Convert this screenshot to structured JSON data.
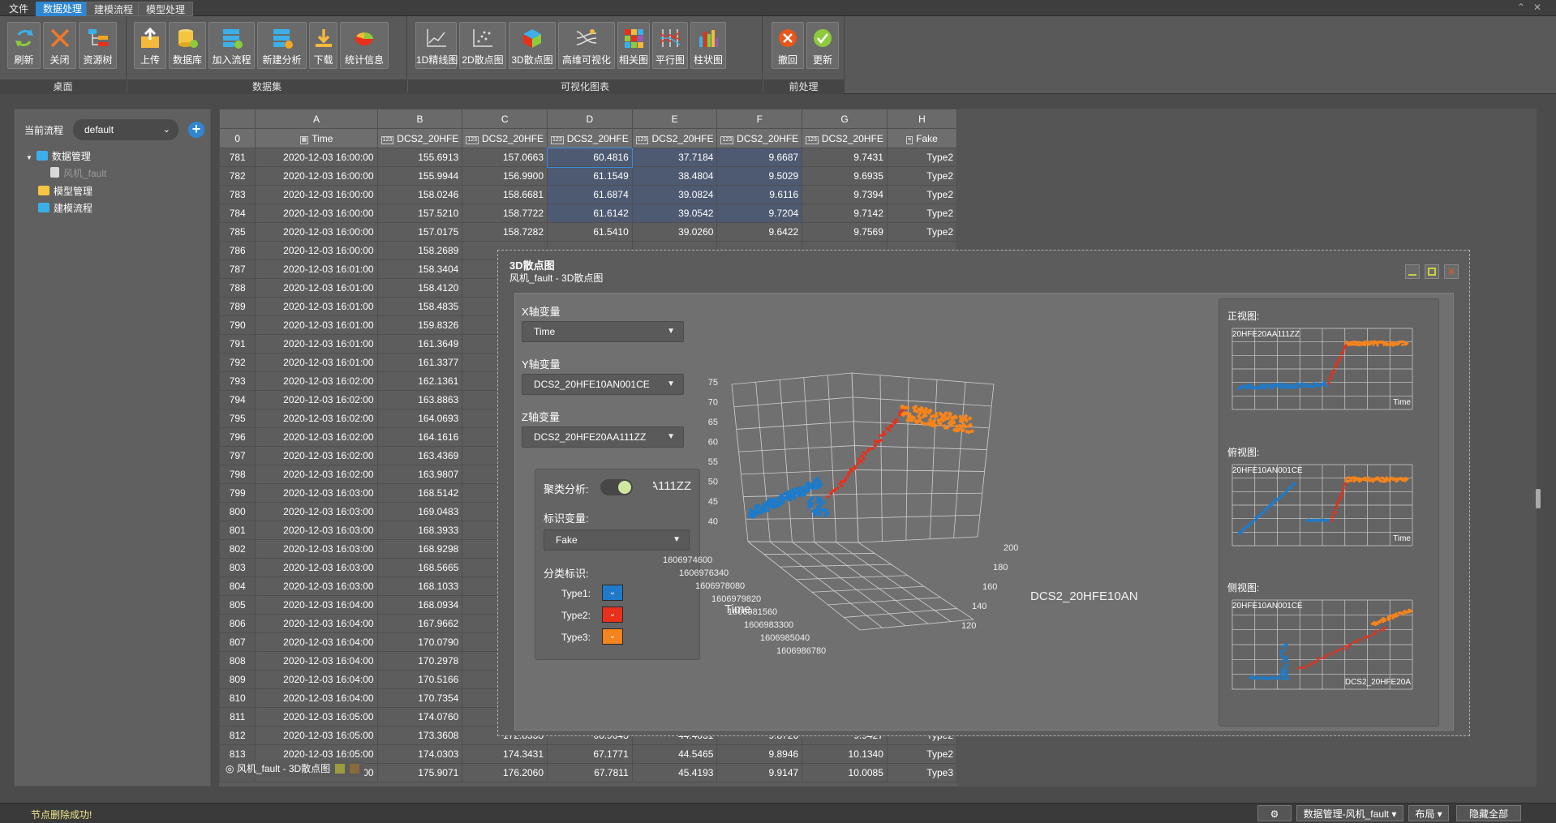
{
  "menubar": {
    "items": [
      "文件",
      "数据处理",
      "建模流程",
      "模型处理"
    ],
    "active": "数据处理"
  },
  "ribbon": {
    "groups": [
      {
        "label": "桌面",
        "buttons": [
          "刷新",
          "关闭",
          "资源树"
        ]
      },
      {
        "label": "数据集",
        "buttons": [
          "上传",
          "数据库",
          "加入流程",
          "新建分析",
          "下载",
          "统计信息"
        ]
      },
      {
        "label": "可视化图表",
        "buttons": [
          "1D精线图",
          "2D散点图",
          "3D散点图",
          "高维可视化",
          "相关图",
          "平行图",
          "柱状图"
        ]
      },
      {
        "label": "前处理",
        "buttons": [
          "撤回",
          "更新"
        ]
      }
    ]
  },
  "sidebar": {
    "flow_label": "当前流程",
    "flow_value": "default",
    "tree": [
      "数据管理",
      "风机_fault",
      "模型管理",
      "建模流程"
    ]
  },
  "grid": {
    "col_letters": [
      "A",
      "B",
      "C",
      "D",
      "E",
      "F",
      "G",
      "H"
    ],
    "header_index": "0",
    "headers": [
      "Time",
      "DCS2_20HFE",
      "DCS2_20HFE",
      "DCS2_20HFE",
      "DCS2_20HFE",
      "DCS2_20HFE",
      "DCS2_20HFE",
      "Fake"
    ],
    "full_rows": [
      [
        "781",
        "2020-12-03 16:00:00",
        "155.6913",
        "157.0663",
        "60.4816",
        "37.7184",
        "9.6687",
        "9.7431",
        "Type2"
      ],
      [
        "782",
        "2020-12-03 16:00:00",
        "155.9944",
        "156.9900",
        "61.1549",
        "38.4804",
        "9.5029",
        "9.6935",
        "Type2"
      ],
      [
        "783",
        "2020-12-03 16:00:00",
        "158.0246",
        "158.6681",
        "61.6874",
        "39.0824",
        "9.6116",
        "9.7394",
        "Type2"
      ],
      [
        "784",
        "2020-12-03 16:00:00",
        "157.5210",
        "158.7722",
        "61.6142",
        "39.0542",
        "9.7204",
        "9.7142",
        "Type2"
      ],
      [
        "785",
        "2020-12-03 16:00:00",
        "157.0175",
        "158.7282",
        "61.5410",
        "39.0260",
        "9.6422",
        "9.7569",
        "Type2"
      ]
    ],
    "partial_rows": [
      [
        "786",
        "2020-12-03 16:00:00",
        "158.2689"
      ],
      [
        "787",
        "2020-12-03 16:01:00",
        "158.3404"
      ],
      [
        "788",
        "2020-12-03 16:01:00",
        "158.4120"
      ],
      [
        "789",
        "2020-12-03 16:01:00",
        "158.4835"
      ],
      [
        "790",
        "2020-12-03 16:01:00",
        "159.8326"
      ],
      [
        "791",
        "2020-12-03 16:01:00",
        "161.3649"
      ],
      [
        "792",
        "2020-12-03 16:01:00",
        "161.3377"
      ],
      [
        "793",
        "2020-12-03 16:02:00",
        "162.1361"
      ],
      [
        "794",
        "2020-12-03 16:02:00",
        "163.8863"
      ],
      [
        "795",
        "2020-12-03 16:02:00",
        "164.0693"
      ],
      [
        "796",
        "2020-12-03 16:02:00",
        "164.1616"
      ],
      [
        "797",
        "2020-12-03 16:02:00",
        "163.4369"
      ],
      [
        "798",
        "2020-12-03 16:02:00",
        "163.9807"
      ],
      [
        "799",
        "2020-12-03 16:03:00",
        "168.5142"
      ],
      [
        "800",
        "2020-12-03 16:03:00",
        "169.0483"
      ],
      [
        "801",
        "2020-12-03 16:03:00",
        "168.3933"
      ],
      [
        "802",
        "2020-12-03 16:03:00",
        "168.9298"
      ],
      [
        "803",
        "2020-12-03 16:03:00",
        "168.5665"
      ],
      [
        "804",
        "2020-12-03 16:03:00",
        "168.1033"
      ],
      [
        "805",
        "2020-12-03 16:04:00",
        "168.0934"
      ],
      [
        "806",
        "2020-12-03 16:04:00",
        "167.9662"
      ],
      [
        "807",
        "2020-12-03 16:04:00",
        "170.0790"
      ],
      [
        "808",
        "2020-12-03 16:04:00",
        "170.2978"
      ],
      [
        "809",
        "2020-12-03 16:04:00",
        "170.5166"
      ],
      [
        "810",
        "2020-12-03 16:04:00",
        "170.7354"
      ],
      [
        "811",
        "2020-12-03 16:05:00",
        "174.0760"
      ]
    ],
    "tail_rows": [
      [
        "812",
        "2020-12-03 16:05:00",
        "173.3608",
        "172.8533",
        "66.9643",
        "44.4031",
        "9.8726",
        "9.9427",
        "Type2"
      ],
      [
        "813",
        "2020-12-03 16:05:00",
        "174.0303",
        "174.3431",
        "67.1771",
        "44.5465",
        "9.8946",
        "10.1340",
        "Type2"
      ],
      [
        "814",
        "2020-12-03 16:05:00",
        "175.9071",
        "176.2060",
        "67.7811",
        "45.4193",
        "9.9147",
        "10.0085",
        "Type3"
      ]
    ],
    "panel_tab": "风机_fault - 3D散点图"
  },
  "dialog": {
    "title": "3D散点图",
    "subtitle": "风机_fault - 3D散点图",
    "x_label": "X轴变量",
    "x_value": "Time",
    "y_label": "Y轴变量",
    "y_value": "DCS2_20HFE10AN001CE",
    "z_label": "Z轴变量",
    "z_value": "DCS2_20HFE20AA111ZZ",
    "cluster_label": "聚类分析:",
    "mark_label": "标识变量:",
    "mark_value": "Fake",
    "class_label": "分类标识:",
    "types": [
      "Type1:",
      "Type2:",
      "Type3:"
    ],
    "type_colors": [
      "#1f7bc9",
      "#e8301a",
      "#f5841c"
    ],
    "views": [
      "正视图:",
      "俯视图:",
      "侧视图:"
    ]
  },
  "chart_data": {
    "type": "scatter",
    "z_axis_title": "A111ZZ",
    "z_ticks": [
      "75",
      "70",
      "65",
      "60",
      "55",
      "50",
      "45",
      "40"
    ],
    "y_axis_title": "DCS2_20HFE10AN",
    "y_ticks": [
      "200",
      "180",
      "160",
      "140",
      "120"
    ],
    "x_axis_title": "Time",
    "x_ticks": [
      "1606974600",
      "1606976340",
      "1606978080",
      "1606979820",
      "1606981560",
      "1606983300",
      "1606985040",
      "1606986780"
    ],
    "series": [
      {
        "name": "Type1",
        "color": "#1f7bc9"
      },
      {
        "name": "Type2",
        "color": "#e8301a"
      },
      {
        "name": "Type3",
        "color": "#f5841c"
      }
    ],
    "front_view": {
      "y_label": "20HFE20AA111ZZ",
      "x_label": "Time"
    },
    "top_view": {
      "y_label": "20HFE10AN001CE",
      "x_label": "Time"
    },
    "side_view": {
      "y_label": "20HFE10AN001CE",
      "x_label": "DCS2_20HFE20A"
    }
  },
  "statusbar": {
    "message": "节点删除成功!",
    "nav": "数据管理-风机_fault ▾",
    "layout": "布局 ▾",
    "hide_all": "隐藏全部"
  }
}
